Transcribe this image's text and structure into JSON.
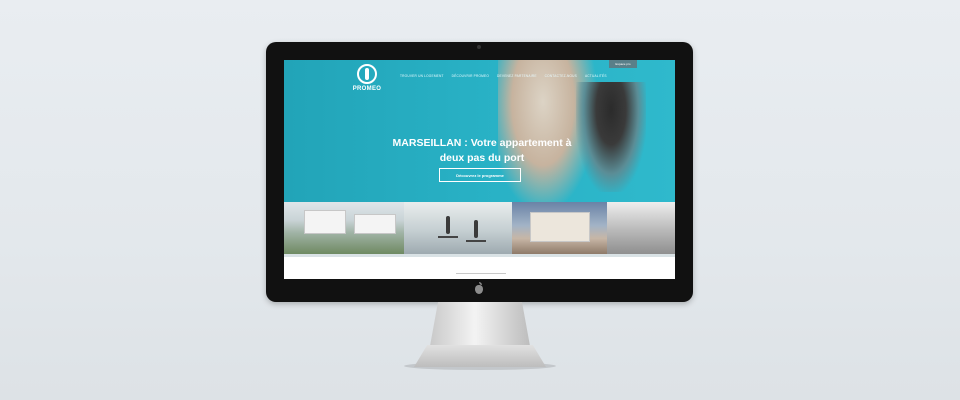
{
  "site": {
    "logo_text": "PROMEO",
    "espace_label": "Espace pro",
    "nav": [
      {
        "label": "TROUVER UN LOGEMENT"
      },
      {
        "label": "DÉCOUVRIR PROMEO"
      },
      {
        "label": "DEVENEZ PARTENAIRE"
      },
      {
        "label": "CONTACTEZ-NOUS"
      },
      {
        "label": "ACTUALITÉS"
      }
    ],
    "hero": {
      "headline": "MARSEILLAN : Votre appartement à deux pas du port",
      "cta_label": "Découvrez le programme"
    }
  },
  "colors": {
    "brand_teal": "#2fb9cc",
    "monitor_bezel": "#111111"
  }
}
